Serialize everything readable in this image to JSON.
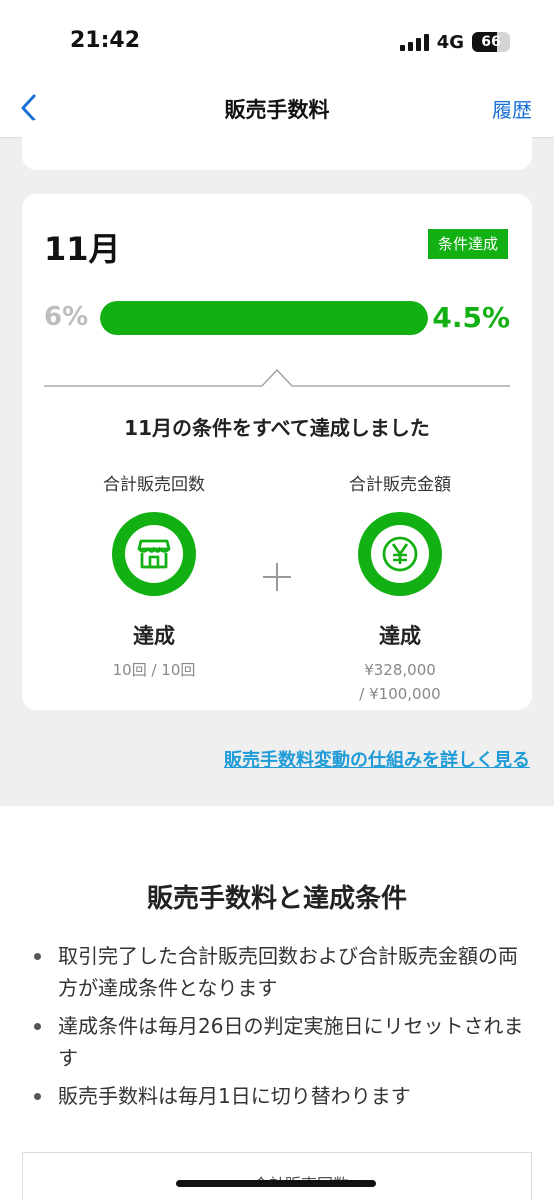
{
  "status_bar": {
    "time": "21:42",
    "network": "4G",
    "battery": "66",
    "battery_level": 0.66
  },
  "nav": {
    "title": "販売手数料",
    "history_label": "履歴"
  },
  "card": {
    "month": "11月",
    "badge": "条件達成",
    "rate_old": "6%",
    "rate_new": "4.5%",
    "progress": 1.0,
    "message": "11月の条件をすべて達成しました",
    "metrics": [
      {
        "label": "合計販売回数",
        "icon": "shop-icon",
        "status": "達成",
        "detail_line1": "10回 / 10回",
        "detail_line2": ""
      },
      {
        "label": "合計販売金額",
        "icon": "yen-icon",
        "status": "達成",
        "detail_line1": "¥328,000",
        "detail_line2": "/ ¥100,000"
      }
    ]
  },
  "link": {
    "text": "販売手数料変動の仕組みを詳しく見る"
  },
  "info": {
    "title": "販売手数料と達成条件",
    "items": [
      "取引完了した合計販売回数および合計販売金額の両方が達成条件となります",
      "達成条件は毎月26日の判定実施日にリセットされます",
      "販売手数料は毎月1日に切り替わります"
    ],
    "bottom_partial": "合計販売回数 +"
  },
  "colors": {
    "accent_green": "#13b013",
    "link_blue": "#1f9bd7",
    "nav_blue": "#1a6fd8"
  }
}
